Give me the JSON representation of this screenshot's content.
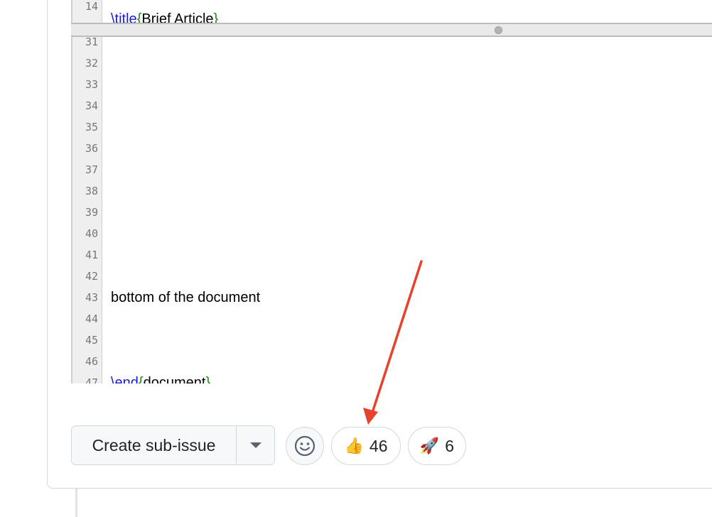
{
  "editor": {
    "top_lines": [
      {
        "num": "14",
        "code_kw": "\\title",
        "code_open": "{",
        "code_text": "Brief Article",
        "code_close": "}"
      }
    ],
    "lines": [
      {
        "num": "31",
        "text": ""
      },
      {
        "num": "32",
        "text": ""
      },
      {
        "num": "33",
        "text": ""
      },
      {
        "num": "34",
        "text": ""
      },
      {
        "num": "35",
        "text": ""
      },
      {
        "num": "36",
        "text": ""
      },
      {
        "num": "37",
        "text": ""
      },
      {
        "num": "38",
        "text": ""
      },
      {
        "num": "39",
        "text": ""
      },
      {
        "num": "40",
        "text": ""
      },
      {
        "num": "41",
        "text": ""
      },
      {
        "num": "42",
        "text": ""
      },
      {
        "num": "43",
        "text": "bottom of the document"
      },
      {
        "num": "44",
        "text": ""
      },
      {
        "num": "45",
        "text": ""
      },
      {
        "num": "46",
        "text": ""
      }
    ],
    "last_line": {
      "num": "47",
      "code_kw": "\\end",
      "code_open": "{",
      "code_text": "document",
      "code_close": "}"
    }
  },
  "actions": {
    "create_sub_issue_label": "Create sub-issue",
    "reactions": [
      {
        "emoji": "👍",
        "count": "46"
      },
      {
        "emoji": "🚀",
        "count": "6"
      }
    ]
  },
  "colors": {
    "annotation_arrow": "#e8412c",
    "latex_command": "#1a1ad6",
    "latex_brace": "#1f8a1f"
  }
}
